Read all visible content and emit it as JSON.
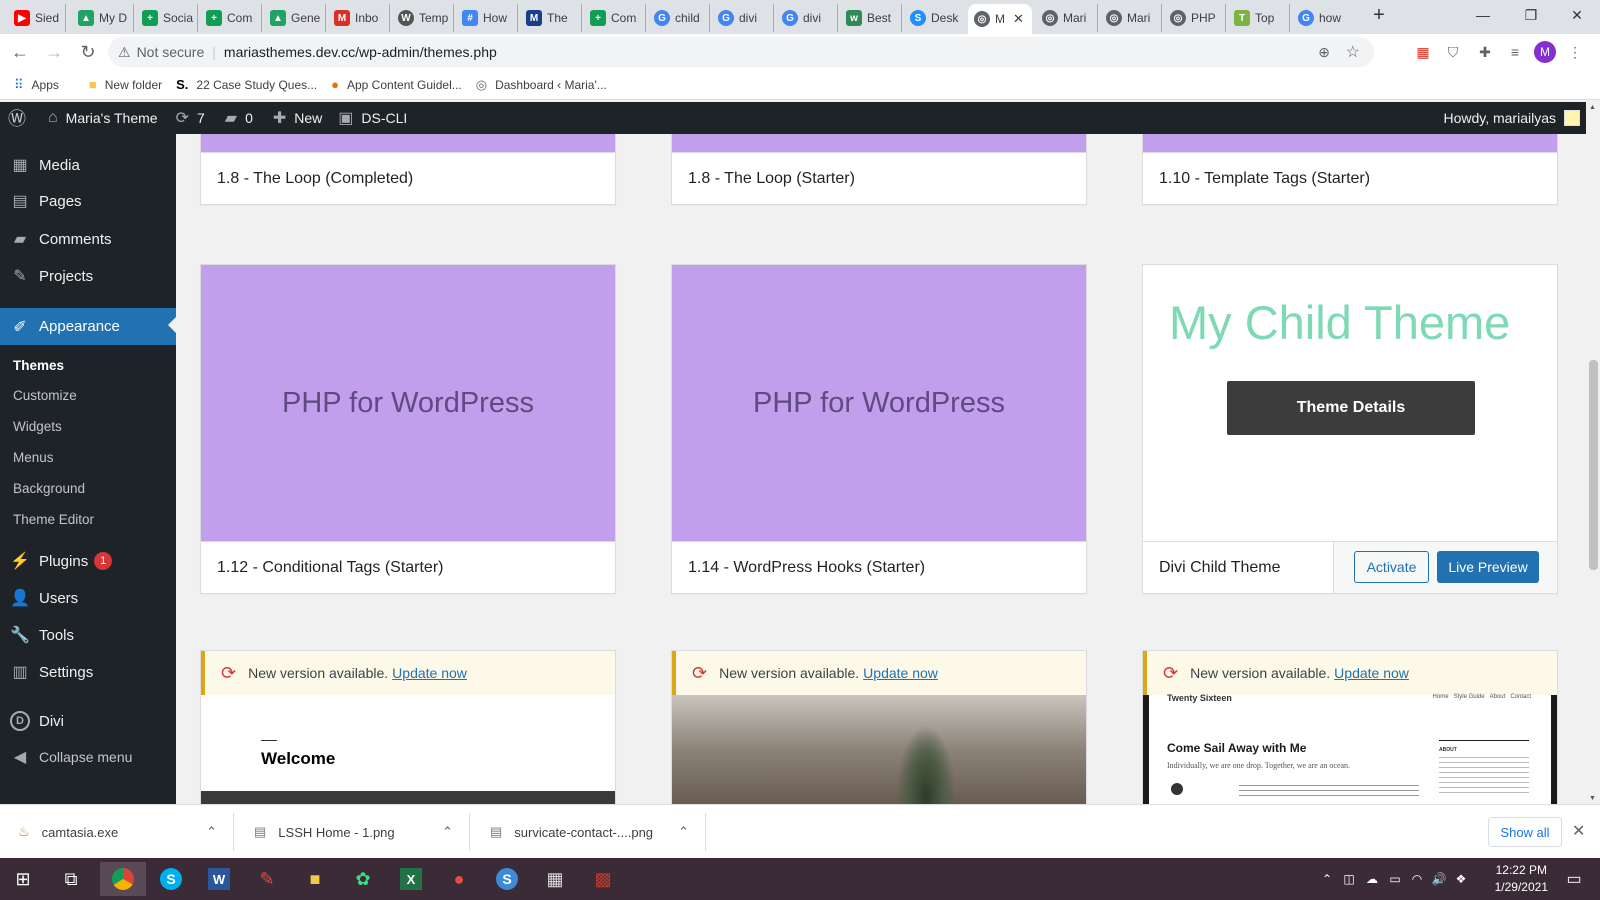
{
  "browser": {
    "tabs": [
      {
        "label": "Sied",
        "icon": "youtube-icon",
        "color": "#ff0000"
      },
      {
        "label": "My D",
        "icon": "drive-icon",
        "color": "#1fa463"
      },
      {
        "label": "Socia",
        "icon": "sheets-icon",
        "color": "#0f9d58"
      },
      {
        "label": "Com",
        "icon": "sheets-icon",
        "color": "#0f9d58"
      },
      {
        "label": "Gene",
        "icon": "drive-icon",
        "color": "#1fa463"
      },
      {
        "label": "Inbo",
        "icon": "gmail-icon",
        "color": "#d93025"
      },
      {
        "label": "Temp",
        "icon": "wordpress-icon",
        "color": "#555555"
      },
      {
        "label": "How",
        "icon": "grid-icon",
        "color": "#4285f4"
      },
      {
        "label": "The",
        "icon": "medium-icon",
        "color": "#1a3e8c"
      },
      {
        "label": "Com",
        "icon": "sheets-icon",
        "color": "#0f9d58"
      },
      {
        "label": "child",
        "icon": "google-icon",
        "color": "#4285f4"
      },
      {
        "label": "divi",
        "icon": "google-icon",
        "color": "#4285f4"
      },
      {
        "label": "divi",
        "icon": "google-icon",
        "color": "#4285f4"
      },
      {
        "label": "Best",
        "icon": "wp-engine-icon",
        "color": "#2e8b57"
      },
      {
        "label": "Desk",
        "icon": "desk-icon",
        "color": "#1e90ff"
      },
      {
        "label": "M",
        "icon": "globe-icon",
        "color": "#5f6368"
      },
      {
        "label": "Mari",
        "icon": "globe-icon",
        "color": "#5f6368"
      },
      {
        "label": "Mari",
        "icon": "globe-icon",
        "color": "#5f6368"
      },
      {
        "label": "PHP",
        "icon": "globe-icon",
        "color": "#5f6368"
      },
      {
        "label": "Top",
        "icon": "top-icon",
        "color": "#7cb342"
      },
      {
        "label": "how",
        "icon": "google-icon",
        "color": "#4285f4"
      }
    ],
    "not_secure": "Not secure",
    "url": "mariasthemes.dev.cc/wp-admin/themes.php",
    "profile_initial": "M",
    "bookmarks": [
      {
        "label": "Apps",
        "icon": "apps-grid-icon"
      },
      {
        "label": "New folder",
        "icon": "folder-icon"
      },
      {
        "label": "22 Case Study Ques...",
        "icon": "s-logo-icon"
      },
      {
        "label": "App Content Guidel...",
        "icon": "color-circle-icon"
      },
      {
        "label": "Dashboard ‹ Maria'...",
        "icon": "globe-icon"
      }
    ]
  },
  "adminbar": {
    "site": "Maria's Theme",
    "updates": "7",
    "comments": "0",
    "new": "New",
    "dscli": "DS-CLI",
    "howdy": "Howdy, mariailyas"
  },
  "sidebar": {
    "media": "Media",
    "pages": "Pages",
    "comments": "Comments",
    "projects": "Projects",
    "appearance": "Appearance",
    "sub": [
      "Themes",
      "Customize",
      "Widgets",
      "Menus",
      "Background",
      "Theme Editor"
    ],
    "plugins": "Plugins",
    "plugins_badge": "1",
    "users": "Users",
    "tools": "Tools",
    "settings": "Settings",
    "divi": "Divi",
    "collapse": "Collapse menu"
  },
  "themes": {
    "row1": [
      "1.8 - The Loop (Completed)",
      "1.8 - The Loop (Starter)",
      "1.10 - Template Tags (Starter)"
    ],
    "row2": [
      {
        "name": "1.12 - Conditional Tags (Starter)",
        "screenshot": "PHP for WordPress"
      },
      {
        "name": "1.14 - WordPress Hooks (Starter)",
        "screenshot": "PHP for WordPress"
      }
    ],
    "divi": {
      "screenshot": "My Child Theme",
      "details": "Theme Details",
      "name": "Divi Child Theme",
      "activate": "Activate",
      "preview": "Live Preview"
    },
    "notice_text": "New version available.",
    "notice_link": "Update now",
    "row3": {
      "welcome": "Welcome",
      "ts_title": "Twenty Sixteen",
      "ts_menu": [
        "Home",
        "Style Guide",
        "About",
        "Contact"
      ],
      "ts_heading": "Come Sail Away with Me",
      "ts_sub": "Individually, we are one drop. Together, we are an ocean.",
      "ts_about": "ABOUT"
    }
  },
  "downloads": {
    "items": [
      "camtasia.exe",
      "LSSH Home - 1.png",
      "survicate-contact-....png"
    ],
    "show_all": "Show all"
  },
  "taskbar": {
    "time": "12:22 PM",
    "date": "1/29/2021"
  },
  "colors": {
    "wp_dark": "#1d2327",
    "wp_blue": "#2271b1",
    "theme_purple": "#c29fec",
    "child_green": "#7ed9b4"
  }
}
